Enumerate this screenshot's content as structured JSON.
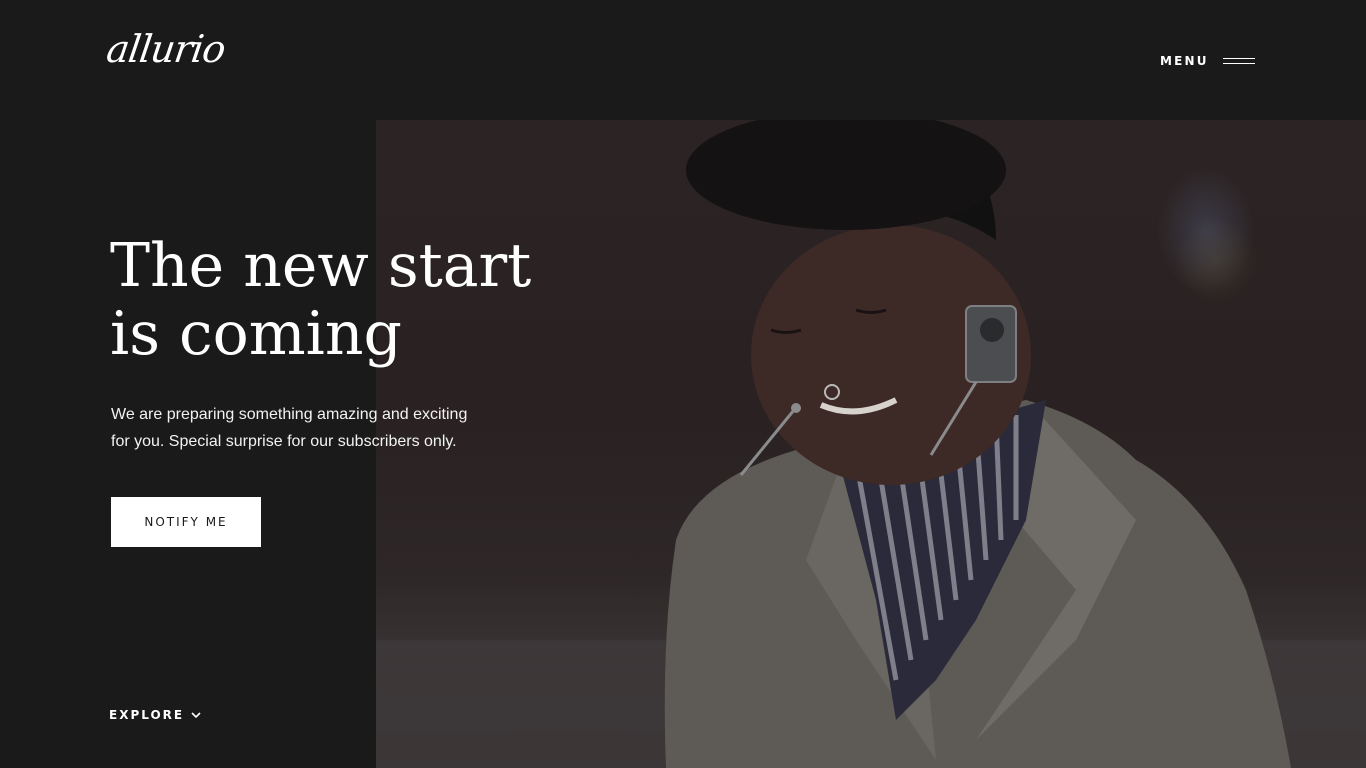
{
  "header": {
    "logo_text": "allurio",
    "menu_label": "MENU"
  },
  "hero": {
    "title_lines": [
      "The new start",
      "is coming"
    ],
    "subtitle_lines": [
      "We are preparing something amazing and exciting",
      "for you. Special surprise for our subscribers only."
    ],
    "cta_label": "NOTIFY ME",
    "image_subject": "smiling woman in beige trench coat and striped shirt"
  },
  "footer": {
    "explore_label": "EXPLORE"
  },
  "icons": {
    "menu": "hamburger-icon",
    "explore": "chevron-down-icon"
  },
  "colors": {
    "background": "#1b1a1b",
    "text": "#ffffff",
    "button_bg": "#ffffff",
    "button_text": "#1b1a1b"
  }
}
